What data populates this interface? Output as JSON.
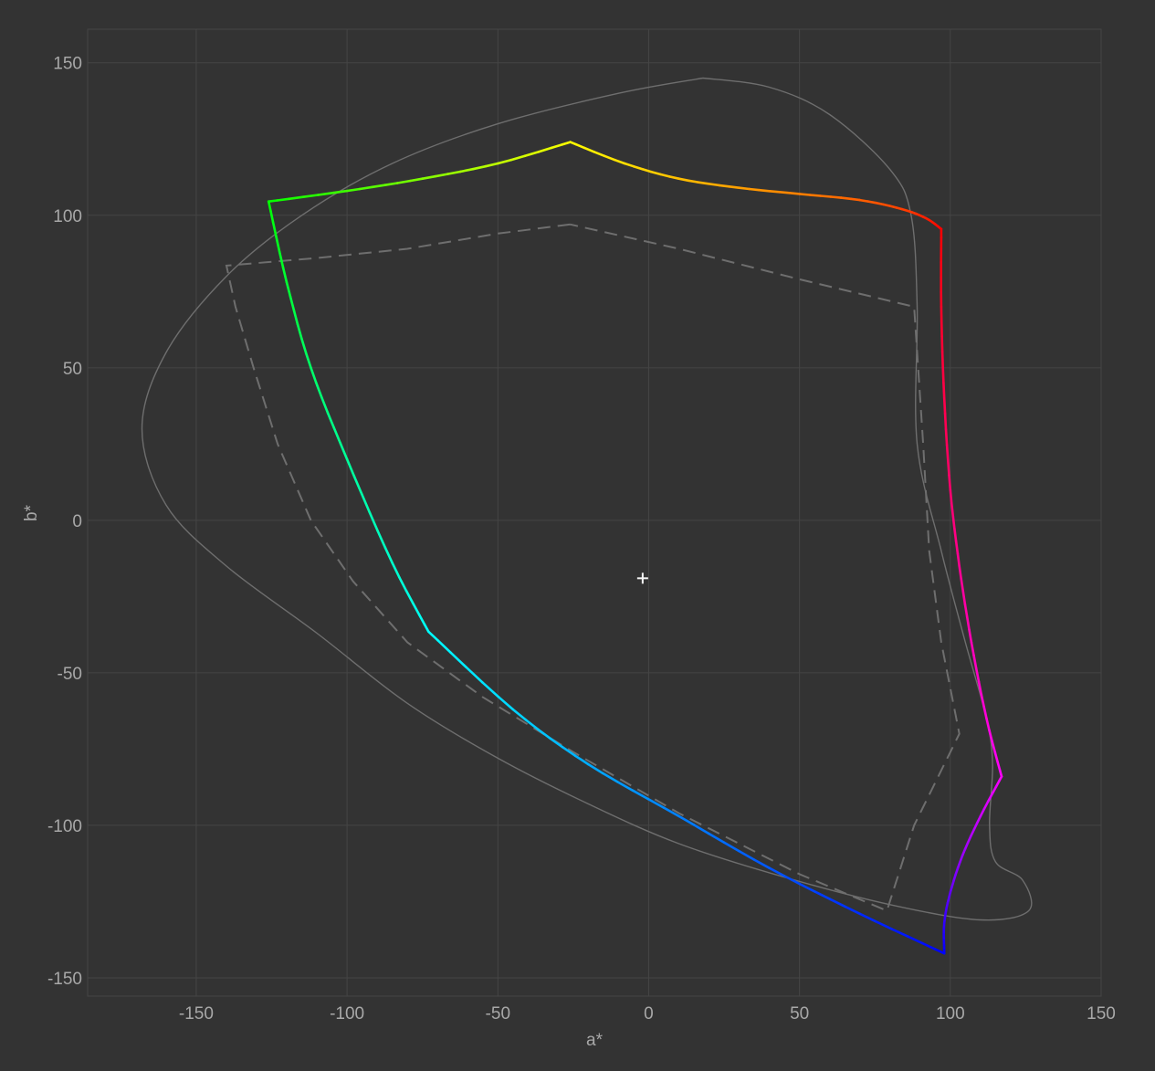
{
  "chart_data": {
    "type": "line",
    "title": "",
    "xlabel": "a*",
    "ylabel": "b*",
    "xlim": [
      -186,
      150
    ],
    "ylim": [
      -156,
      161
    ],
    "x_ticks": [
      -150,
      -100,
      -50,
      0,
      50,
      100,
      150
    ],
    "y_ticks": [
      -150,
      -100,
      -50,
      0,
      50,
      100,
      150
    ],
    "x_tick_labels": [
      "-150",
      "-100",
      "-50",
      "0",
      "50",
      "100",
      "150"
    ],
    "y_tick_labels": [
      "-150",
      "-100",
      "-50",
      "0",
      "50",
      "100",
      "150"
    ],
    "grid": true,
    "legend": "none",
    "colors": {
      "background": "#333333",
      "grid": "#454545",
      "reference": "#6e6e6e",
      "label": "#a8a8a8",
      "white_point": "#f5f5f5"
    },
    "white_point": {
      "x": -2,
      "y": -19
    },
    "series": [
      {
        "style": "gradient-solid",
        "segments": [
          {
            "from": "#ffff00",
            "to": "#ff0000",
            "points": [
              [
                -26,
                124
              ],
              [
                -8,
                117
              ],
              [
                10,
                112
              ],
              [
                30,
                109
              ],
              [
                50,
                107
              ],
              [
                70,
                105
              ],
              [
                84,
                102
              ],
              [
                92,
                99
              ],
              [
                97,
                95.5
              ]
            ]
          },
          {
            "from": "#ff0000",
            "to": "#ff00ff",
            "points": [
              [
                97,
                95.5
              ],
              [
                97,
                70
              ],
              [
                98,
                40
              ],
              [
                100,
                10
              ],
              [
                103,
                -15
              ],
              [
                107,
                -40
              ],
              [
                112,
                -65
              ],
              [
                117,
                -84
              ]
            ]
          },
          {
            "from": "#ff00ff",
            "to": "#0000ff",
            "points": [
              [
                117,
                -84
              ],
              [
                110,
                -97
              ],
              [
                104,
                -110
              ],
              [
                100,
                -122
              ],
              [
                98,
                -132
              ],
              [
                98,
                -142
              ]
            ]
          },
          {
            "from": "#0000ff",
            "to": "#00ffff",
            "points": [
              [
                98,
                -142
              ],
              [
                70,
                -129
              ],
              [
                40,
                -114
              ],
              [
                10,
                -97
              ],
              [
                -20,
                -80
              ],
              [
                -45,
                -62
              ],
              [
                -73,
                -36.5
              ]
            ]
          },
          {
            "from": "#00ffff",
            "to": "#00ff00",
            "points": [
              [
                -73,
                -36.5
              ],
              [
                -85,
                -14
              ],
              [
                -100,
                20
              ],
              [
                -112,
                50
              ],
              [
                -120,
                78
              ],
              [
                -126,
                104.5
              ]
            ]
          },
          {
            "from": "#00ff00",
            "to": "#ffff00",
            "points": [
              [
                -126,
                104.5
              ],
              [
                -100,
                108
              ],
              [
                -75,
                112
              ],
              [
                -50,
                117
              ],
              [
                -26,
                124
              ]
            ]
          }
        ]
      },
      {
        "style": "dashed",
        "points": [
          [
            -26,
            97
          ],
          [
            -50,
            94
          ],
          [
            -80,
            89
          ],
          [
            -110,
            86
          ],
          [
            -140,
            83.5
          ],
          [
            -137,
            70
          ],
          [
            -131,
            50
          ],
          [
            -123,
            25
          ],
          [
            -112,
            0
          ],
          [
            -98,
            -20
          ],
          [
            -80,
            -40
          ],
          [
            -55,
            -58
          ],
          [
            -25,
            -76
          ],
          [
            10,
            -96
          ],
          [
            50,
            -116
          ],
          [
            79,
            -128
          ],
          [
            88,
            -100
          ],
          [
            103,
            -70
          ],
          [
            97,
            -40
          ],
          [
            93,
            -10
          ],
          [
            91,
            25
          ],
          [
            88,
            70
          ],
          [
            50,
            79
          ],
          [
            10,
            89
          ],
          [
            -26,
            97
          ]
        ]
      },
      {
        "style": "solid-thin",
        "points": [
          [
            18,
            145
          ],
          [
            -10,
            140
          ],
          [
            -50,
            130
          ],
          [
            -85,
            117
          ],
          [
            -115,
            100
          ],
          [
            -140,
            80
          ],
          [
            -160,
            55
          ],
          [
            -168,
            30
          ],
          [
            -160,
            5
          ],
          [
            -140,
            -15
          ],
          [
            -110,
            -37
          ],
          [
            -80,
            -60
          ],
          [
            -50,
            -78
          ],
          [
            -20,
            -93
          ],
          [
            10,
            -106
          ],
          [
            45,
            -117
          ],
          [
            80,
            -126
          ],
          [
            110,
            -131
          ],
          [
            126,
            -128
          ],
          [
            124,
            -118
          ],
          [
            115,
            -112
          ],
          [
            113,
            -100
          ],
          [
            114,
            -80
          ],
          [
            112,
            -65
          ],
          [
            105,
            -40
          ],
          [
            97,
            -10
          ],
          [
            89,
            25
          ],
          [
            89,
            70
          ],
          [
            87,
            100
          ],
          [
            80,
            115
          ],
          [
            60,
            133
          ],
          [
            40,
            142
          ],
          [
            18,
            145
          ]
        ]
      }
    ]
  }
}
